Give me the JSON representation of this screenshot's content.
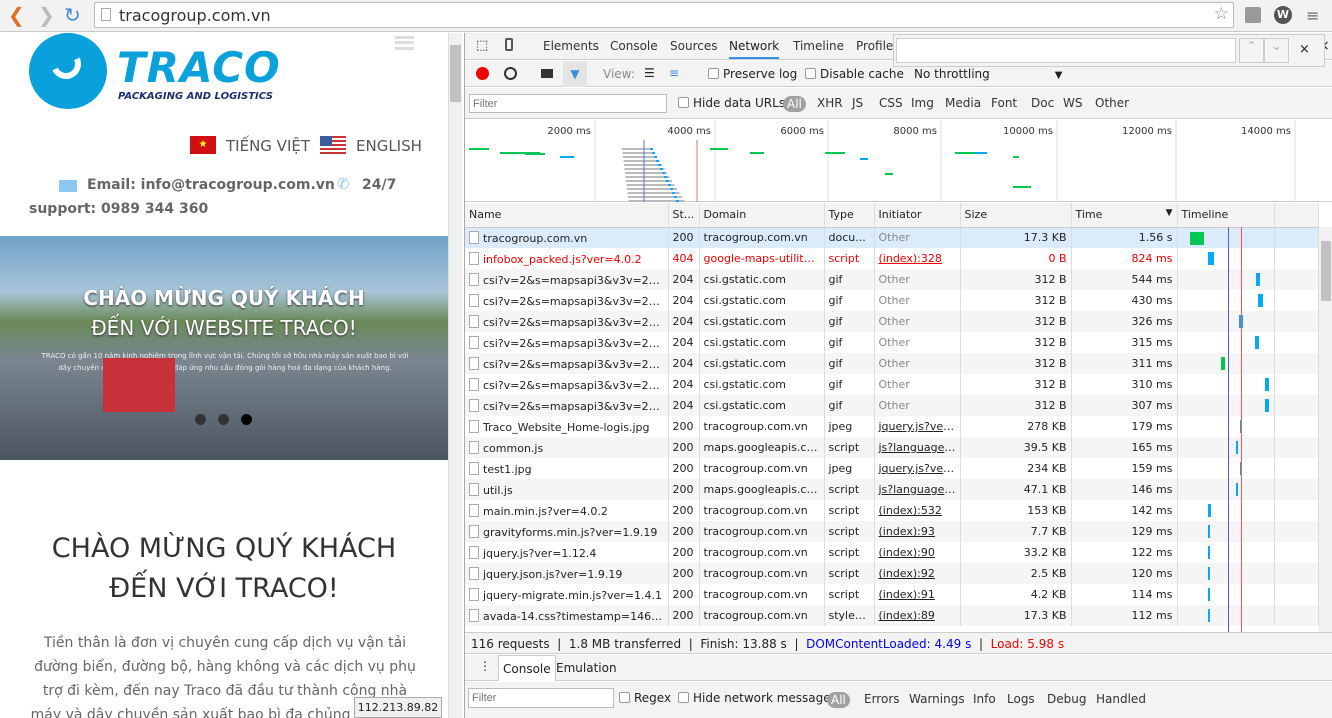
{
  "browser": {
    "url": "tracogroup.com.vn",
    "back_icon": "chevron-left",
    "forward_icon": "chevron-right",
    "reload_icon": "reload",
    "status_ip": "112.213.89.82"
  },
  "site": {
    "logo_text": "TRACO",
    "logo_sub": "PACKAGING AND LOGISTICS",
    "lang_vi": "TIẾNG VIỆT",
    "lang_en": "ENGLISH",
    "email": "Email: info@tracogroup.com.vn",
    "support_a": "24/7",
    "support_b": "support: 0989 344 360",
    "hero_title_1": "CHÀO MỪNG QUÝ KHÁCH",
    "hero_title_2": "ĐẾN VỚI WEBSITE TRACO!",
    "hero_text": "TRACO có gần 10 năm kinh nghiệm trong lĩnh vực vận tải. Chúng tôi sở hữu nhà máy sản xuất bao bì với dây chuyền công nghệ tiên tiến, đáp ứng nhu cầu đóng gói hàng hoá đa dạng của khách hàng.",
    "heading_1": "CHÀO MỪNG QUÝ KHÁCH",
    "heading_2": "ĐẾN VỚI TRACO!",
    "body": "Tiền thân là đơn vị chuyên cung cấp dịch vụ vận tải đường biển, đường bộ, hàng không và các dịch vụ phụ trợ đi kèm, đến nay Traco đã đầu tư thành công nhà máy và dây chuyền sản xuất bao bì đa chủng loại, chất lượng tốt, đáp ứng"
  },
  "devtools": {
    "tabs": [
      "Elements",
      "Console",
      "Sources",
      "Network",
      "Timeline",
      "Profile"
    ],
    "active_tab": "Network",
    "toolbar": {
      "view_label": "View:",
      "preserve_log": "Preserve log",
      "disable_cache": "Disable cache",
      "throttling": "No throttling"
    },
    "filter": {
      "placeholder": "Filter",
      "hide_data_urls": "Hide data URLs",
      "types": [
        "All",
        "XHR",
        "JS",
        "CSS",
        "Img",
        "Media",
        "Font",
        "Doc",
        "WS",
        "Other"
      ]
    },
    "overview_ticks": [
      "2000 ms",
      "4000 ms",
      "6000 ms",
      "8000 ms",
      "10000 ms",
      "12000 ms",
      "14000 ms"
    ],
    "columns": [
      "Name",
      "St...",
      "Domain",
      "Type",
      "Initiator",
      "Size",
      "Time",
      "Timeline"
    ],
    "rows": [
      [
        "tracogroup.com.vn",
        "200",
        "tracogroup.com.vn",
        "docu...",
        "Other",
        "17.3 KB",
        "1.56 s"
      ],
      [
        "infobox_packed.js?ver=4.0.2",
        "404",
        "google-maps-utility-...",
        "script",
        "(index):328",
        "0 B",
        "824 ms"
      ],
      [
        "csi?v=2&s=mapsapi3&v3v=25.7&...",
        "204",
        "csi.gstatic.com",
        "gif",
        "Other",
        "312 B",
        "544 ms"
      ],
      [
        "csi?v=2&s=mapsapi3&v3v=25.7&...",
        "204",
        "csi.gstatic.com",
        "gif",
        "Other",
        "312 B",
        "430 ms"
      ],
      [
        "csi?v=2&s=mapsapi3&v3v=25.7&...",
        "204",
        "csi.gstatic.com",
        "gif",
        "Other",
        "312 B",
        "326 ms"
      ],
      [
        "csi?v=2&s=mapsapi3&v3v=25.7&...",
        "204",
        "csi.gstatic.com",
        "gif",
        "Other",
        "312 B",
        "315 ms"
      ],
      [
        "csi?v=2&s=mapsapi3&v3v=25.7&...",
        "204",
        "csi.gstatic.com",
        "gif",
        "Other",
        "312 B",
        "311 ms"
      ],
      [
        "csi?v=2&s=mapsapi3&v3v=25.7&...",
        "204",
        "csi.gstatic.com",
        "gif",
        "Other",
        "312 B",
        "310 ms"
      ],
      [
        "csi?v=2&s=mapsapi3&v3v=25.7&...",
        "204",
        "csi.gstatic.com",
        "gif",
        "Other",
        "312 B",
        "307 ms"
      ],
      [
        "Traco_Website_Home-logis.jpg",
        "200",
        "tracogroup.com.vn",
        "jpeg",
        "jquery.js?ver...",
        "278 KB",
        "179 ms"
      ],
      [
        "common.js",
        "200",
        "maps.googleapis.com",
        "script",
        "js?language=...",
        "39.5 KB",
        "165 ms"
      ],
      [
        "test1.jpg",
        "200",
        "tracogroup.com.vn",
        "jpeg",
        "jquery.js?ver...",
        "234 KB",
        "159 ms"
      ],
      [
        "util.js",
        "200",
        "maps.googleapis.com",
        "script",
        "js?language=...",
        "47.1 KB",
        "146 ms"
      ],
      [
        "main.min.js?ver=4.0.2",
        "200",
        "tracogroup.com.vn",
        "script",
        "(index):532",
        "153 KB",
        "142 ms"
      ],
      [
        "gravityforms.min.js?ver=1.9.19",
        "200",
        "tracogroup.com.vn",
        "script",
        "(index):93",
        "7.7 KB",
        "129 ms"
      ],
      [
        "jquery.js?ver=1.12.4",
        "200",
        "tracogroup.com.vn",
        "script",
        "(index):90",
        "33.2 KB",
        "122 ms"
      ],
      [
        "jquery.json.js?ver=1.9.19",
        "200",
        "tracogroup.com.vn",
        "script",
        "(index):92",
        "2.5 KB",
        "120 ms"
      ],
      [
        "jquery-migrate.min.js?ver=1.4.1",
        "200",
        "tracogroup.com.vn",
        "script",
        "(index):91",
        "4.2 KB",
        "114 ms"
      ],
      [
        "avada-14.css?timestamp=146762...",
        "200",
        "tracogroup.com.vn",
        "styles...",
        "(index):89",
        "17.3 KB",
        "112 ms"
      ]
    ],
    "status": {
      "requests": "116 requests",
      "transferred": "1.8 MB transferred",
      "finish": "Finish: 13.88 s",
      "dcl": "DOMContentLoaded: 4.49 s",
      "load": "Load: 5.98 s"
    },
    "drawer_tabs": [
      "Console",
      "Emulation"
    ],
    "console_filter": {
      "placeholder": "Filter",
      "regex": "Regex",
      "hide_network": "Hide network messages",
      "levels": [
        "All",
        "Errors",
        "Warnings",
        "Info",
        "Logs",
        "Debug",
        "Handled"
      ]
    },
    "colors": {
      "error": "#e00000",
      "dcl": "#0000ee",
      "load": "#e00000",
      "bar_green": "#00c853",
      "bar_blue": "#03a9f4"
    }
  }
}
